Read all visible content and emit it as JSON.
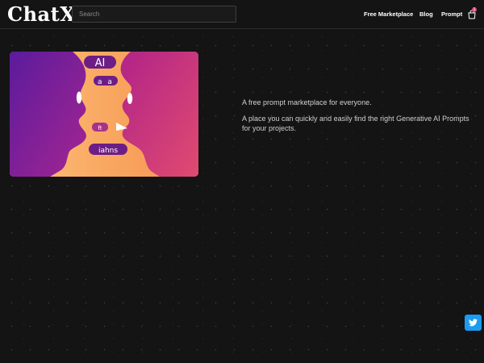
{
  "header": {
    "logo": "ChatX",
    "search_placeholder": "Search",
    "nav": [
      "Free Marketplace",
      "Blog",
      "Prompt"
    ],
    "cart_count": "1"
  },
  "hero_image": {
    "labels": [
      "AI",
      "a a",
      "ft",
      "iahns"
    ],
    "colors": {
      "purple": "#6a1fa8",
      "magenta": "#c0288f",
      "orange": "#f59a55",
      "peach": "#fdc27a"
    }
  },
  "intro": {
    "line1": "A free prompt marketplace for everyone.",
    "line2": "A place you can quickly and easily find the right Generative AI Prompts for your projects."
  },
  "social": {
    "twitter_icon": "twitter-icon",
    "accent": "#1d9bf0"
  }
}
